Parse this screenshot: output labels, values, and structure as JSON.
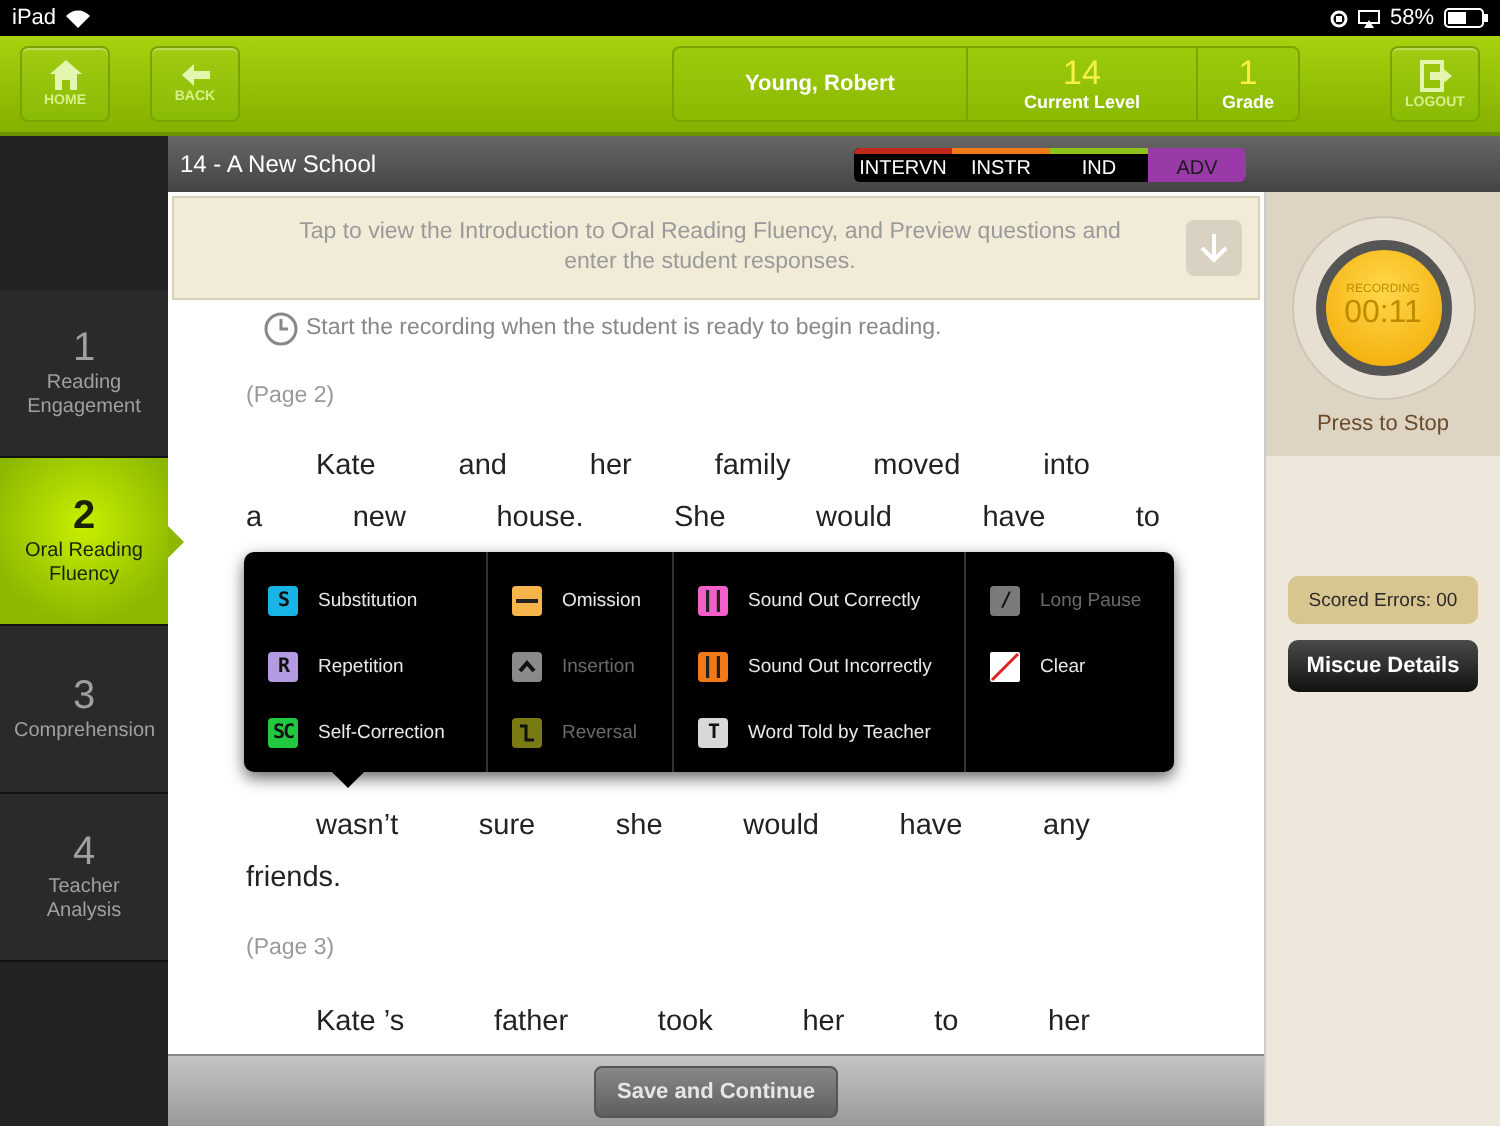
{
  "status_bar": {
    "device": "iPad",
    "battery": "58%"
  },
  "header": {
    "home": "HOME",
    "back": "BACK",
    "student": "Young, Robert",
    "level": {
      "value": "14",
      "label": "Current Level"
    },
    "grade": {
      "value": "1",
      "label": "Grade"
    },
    "logout": "LOGOUT"
  },
  "steps": [
    {
      "number": "1",
      "label": "Reading Engagement",
      "selected": false
    },
    {
      "number": "2",
      "label": "Oral Reading Fluency",
      "selected": true
    },
    {
      "number": "3",
      "label": "Comprehension",
      "selected": false
    },
    {
      "number": "4",
      "label": "Teacher Analysis",
      "selected": false
    }
  ],
  "title": "14 - A New School",
  "levels": [
    {
      "label": "INTERVN",
      "color": "#c0281c",
      "selected": false
    },
    {
      "label": "INSTR",
      "color": "#f07a1a",
      "selected": false
    },
    {
      "label": "IND",
      "color": "#8cc21a",
      "selected": false
    },
    {
      "label": "ADV",
      "color": "#9a3aa8",
      "selected": true
    }
  ],
  "banner": "Tap to view the Introduction to Oral Reading Fluency, and Preview questions and enter the student responses.",
  "instruction": "Start the recording when the student is ready to begin reading.",
  "passage": [
    {
      "kind": "page",
      "text": "(Page 2)"
    },
    {
      "kind": "line",
      "indented": true,
      "justified": true,
      "words": [
        "Kate",
        "and",
        "her",
        "family",
        "moved",
        "into"
      ]
    },
    {
      "kind": "line",
      "indented": false,
      "justified": true,
      "words": [
        "a",
        "new",
        "house.",
        "She",
        "would",
        "have",
        "to"
      ]
    }
  ],
  "miscues": [
    [
      {
        "kind": "letter",
        "symbol": "S",
        "label": "Substitution",
        "color": "#19b4e6",
        "disabled": false
      },
      {
        "kind": "letter",
        "symbol": "R",
        "label": "Repetition",
        "color": "#b49ae0",
        "disabled": false
      },
      {
        "kind": "letter",
        "symbol": "SC",
        "label": "Self-Correction",
        "color": "#22c840",
        "disabled": false
      }
    ],
    [
      {
        "kind": "bar",
        "label": "Omission",
        "color": "#f5b54a",
        "disabled": false
      },
      {
        "kind": "caret",
        "label": "Insertion",
        "color": "#8a8a8a",
        "disabled": true
      },
      {
        "kind": "reversal",
        "label": "Reversal",
        "color": "#7a7a12",
        "disabled": true
      }
    ],
    [
      {
        "kind": "bars",
        "label": "Sound Out Correctly",
        "color": "#f060c8",
        "disabled": false
      },
      {
        "kind": "bars",
        "label": "Sound Out Incorrectly",
        "color": "#f07a1a",
        "disabled": false
      },
      {
        "kind": "letter",
        "symbol": "T",
        "label": "Word Told by Teacher",
        "color": "#d8d8d8",
        "disabled": false
      }
    ],
    [
      {
        "kind": "letter",
        "symbol": "/",
        "label": "Long Pause",
        "color": "#7a7a7a",
        "disabled": true
      },
      {
        "kind": "clear",
        "label": "Clear",
        "color": "#ffffff",
        "disabled": false
      }
    ]
  ],
  "passage_continued": [
    {
      "kind": "line",
      "indented": true,
      "justified": true,
      "words": [
        "wasn’t",
        "sure",
        "she",
        "would",
        "have",
        "any"
      ]
    },
    {
      "kind": "line",
      "indented": false,
      "words": [
        "friends."
      ]
    },
    {
      "kind": "page",
      "text": "(Page 3)"
    },
    {
      "kind": "line",
      "indented": true,
      "justified": true,
      "words": [
        "Kate ’s",
        "father",
        "took",
        "her",
        "to",
        "her"
      ]
    }
  ],
  "recording": {
    "label": "RECORDING",
    "time": "00:11",
    "hint": "Press to Stop"
  },
  "scored_errors": "Scored Errors: 00",
  "miscue_button": "Miscue Details",
  "save_button": "Save and Continue"
}
